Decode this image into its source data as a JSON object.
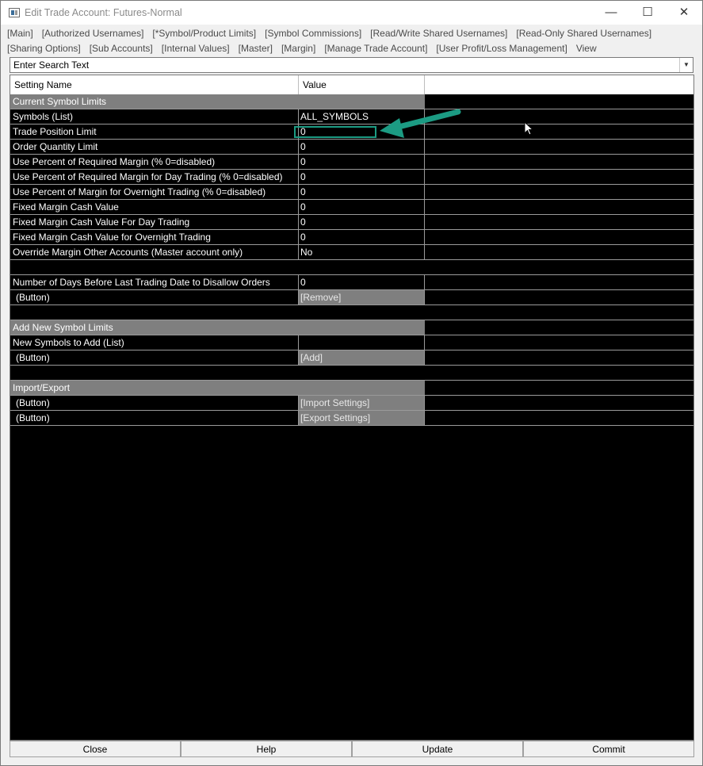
{
  "window": {
    "title": "Edit Trade Account: Futures-Normal",
    "min_glyph": "—",
    "max_glyph": "☐",
    "close_glyph": "✕",
    "icon": "app-window-icon"
  },
  "menu_row1": [
    "[Main]",
    "[Authorized Usernames]",
    "[*Symbol/Product Limits]",
    "[Symbol Commissions]",
    "[Read/Write Shared Usernames]",
    "[Read-Only Shared Usernames]"
  ],
  "menu_row2": [
    "[Sharing Options]",
    "[Sub Accounts]",
    "[Internal Values]",
    "[Master]",
    "[Margin]",
    "[Manage Trade Account]",
    "[User Profit/Loss Management]",
    "View"
  ],
  "search": {
    "value": "Enter Search Text",
    "dropdown_glyph": "▼"
  },
  "grid": {
    "headers": [
      "Setting Name",
      "Value",
      ""
    ],
    "rows": [
      {
        "type": "section",
        "name": "Current Symbol Limits",
        "value": ""
      },
      {
        "type": "item",
        "name": "Symbols (List)",
        "value": "ALL_SYMBOLS"
      },
      {
        "type": "item",
        "name": "Trade Position Limit",
        "value": "0",
        "selected": true
      },
      {
        "type": "item",
        "name": "Order Quantity Limit",
        "value": "0"
      },
      {
        "type": "item",
        "name": "Use Percent of Required Margin (% 0=disabled)",
        "value": "0"
      },
      {
        "type": "item",
        "name": "Use Percent of Required Margin for Day Trading (% 0=disabled)",
        "value": "0"
      },
      {
        "type": "item",
        "name": "Use Percent of Margin for Overnight Trading (% 0=disabled)",
        "value": "0"
      },
      {
        "type": "item",
        "name": "Fixed Margin Cash Value",
        "value": "0"
      },
      {
        "type": "item",
        "name": "Fixed Margin Cash Value For Day Trading",
        "value": "0"
      },
      {
        "type": "item",
        "name": "Fixed Margin Cash Value for Overnight Trading",
        "value": "0"
      },
      {
        "type": "item",
        "name": "Override Margin Other Accounts (Master account only)",
        "value": "No"
      },
      {
        "type": "blank",
        "name": "",
        "value": ""
      },
      {
        "type": "item",
        "name": "Number of Days Before Last Trading Date to Disallow Orders",
        "value": "0"
      },
      {
        "type": "btn",
        "name": "(Button)",
        "value": "[Remove]"
      },
      {
        "type": "blank",
        "name": "",
        "value": ""
      },
      {
        "type": "section",
        "name": "Add New Symbol Limits",
        "value": ""
      },
      {
        "type": "item",
        "name": "New Symbols to Add (List)",
        "value": ""
      },
      {
        "type": "btn",
        "name": "(Button)",
        "value": "[Add]"
      },
      {
        "type": "blank",
        "name": "",
        "value": ""
      },
      {
        "type": "section",
        "name": "Import/Export",
        "value": ""
      },
      {
        "type": "btn",
        "name": "(Button)",
        "value": "[Import Settings]"
      },
      {
        "type": "btn",
        "name": "(Button)",
        "value": "[Export Settings]"
      }
    ]
  },
  "annotation": {
    "color": "#1c9b83"
  },
  "footer": {
    "close": "Close",
    "help": "Help",
    "update": "Update",
    "commit": "Commit"
  }
}
